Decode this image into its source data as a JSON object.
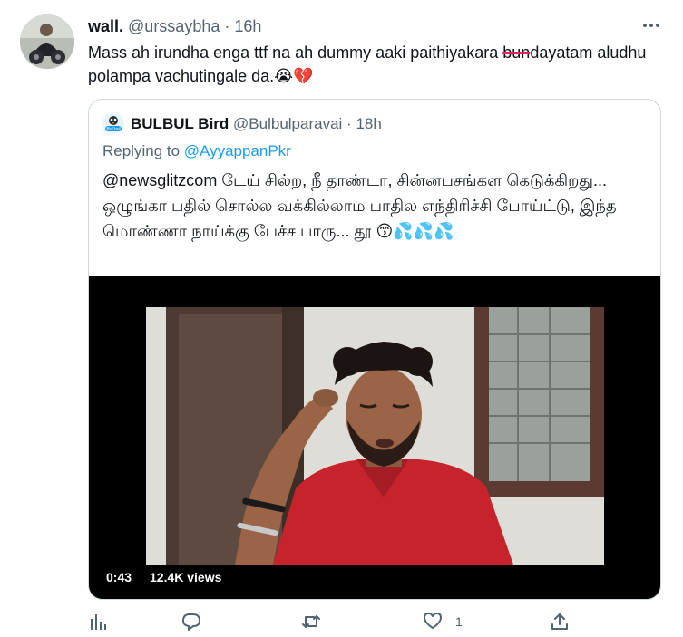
{
  "tweet": {
    "display_name": "wall.",
    "handle": "@urssaybha",
    "separator": "·",
    "time": "16h",
    "more_icon": "more-dots-icon",
    "text_before": "Mass ah irundha enga ttf na ah dummy aaki paithiyakara ",
    "text_struck": "bun",
    "text_after": "dayatam aludhu polampa vachutingale da.",
    "emojis": [
      "😭",
      "💔"
    ]
  },
  "quoted": {
    "display_name": "BULBUL Bird",
    "handle": "@Bulbulparavai",
    "separator": "·",
    "time": "18h",
    "avatar_text": "Bul bul",
    "replying_prefix": "Replying to ",
    "replying_to": "@AyyappanPkr",
    "text": "@newsglitzcom டேய் சில்ற, நீ தாண்டா, சின்னபசங்கள கெடுக்கிறது... ஒழுங்கா பதில் சொல்ல வக்கில்லாம பாதில எந்திரிச்சி போய்ட்டு, இந்த மொண்ணா நாய்க்கு பேச்ச பாரு... தூ",
    "emojis": "😙💦💦💦",
    "video": {
      "duration": "0:43",
      "views": "12.4K views"
    }
  },
  "actions": {
    "analytics_icon": "analytics-icon",
    "reply_icon": "reply-icon",
    "retweet_icon": "retweet-icon",
    "like_icon": "like-icon",
    "like_count": "1",
    "share_icon": "share-icon"
  }
}
